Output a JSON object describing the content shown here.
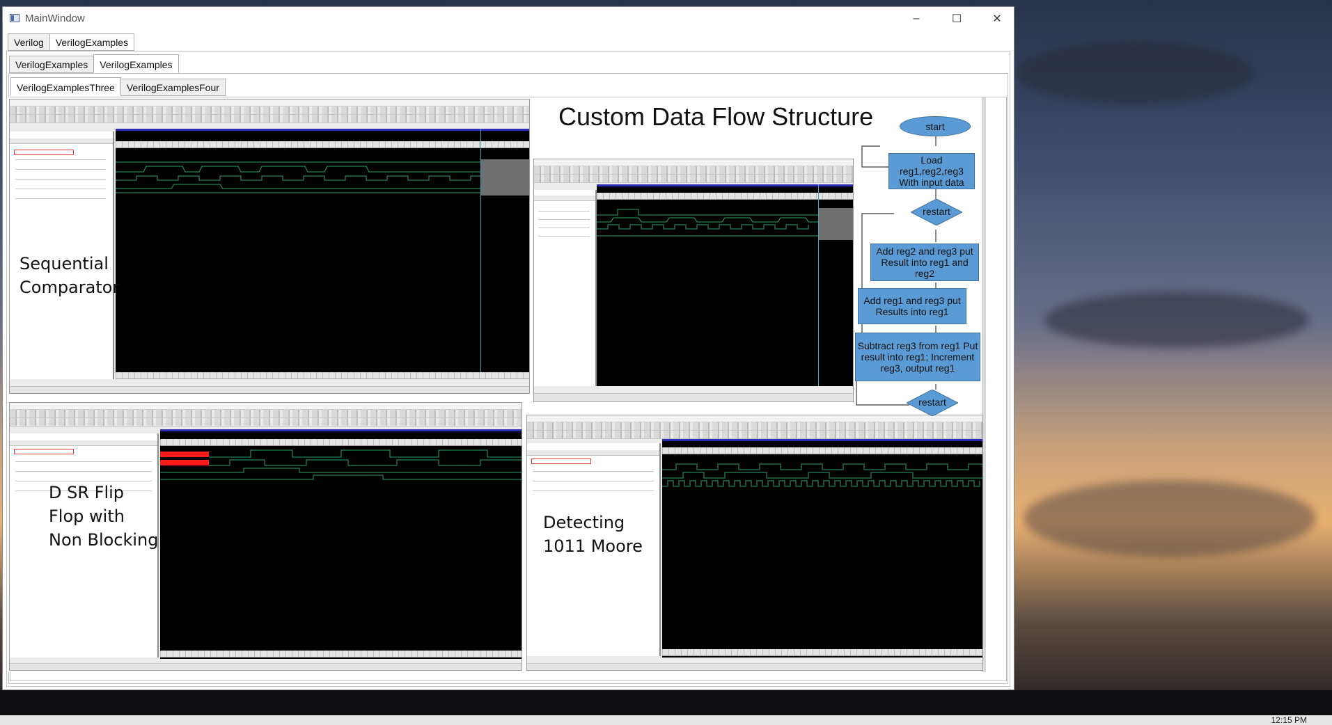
{
  "window": {
    "title": "MainWindow",
    "minimize": "–",
    "maximize": "☐",
    "close": "✕"
  },
  "tabs_level1": [
    "Verilog",
    "VerilogExamples"
  ],
  "tabs_level2": [
    "VerilogExamples",
    "VerilogExamples"
  ],
  "tabs_level3": [
    "VerilogExamplesThree",
    "VerilogExamplesFour"
  ],
  "slide": {
    "heading": "Custom Data Flow Structure",
    "panels": [
      {
        "label_line1": "Sequential",
        "label_line2": "Comparator"
      },
      {
        "label_line1": "D SR Flip",
        "label_line2": "Flop with",
        "label_line3": "Non Blocking"
      },
      {
        "label_line1": "Detecting",
        "label_line2": "1011 Moore"
      }
    ],
    "flowchart": {
      "start": "start",
      "load": "Load reg1,reg2,reg3 With input data",
      "restart1": "restart",
      "add23": "Add reg2 and reg3 put Result into reg1 and reg2",
      "add13": "Add reg1 and reg3 put Results into reg1",
      "subtract": "Subtract reg3 from reg1 Put result into reg1; Increment reg3, output reg1",
      "restart2": "restart"
    },
    "colors": {
      "shape_fill": "#5b9bd5",
      "shape_border": "#41719c",
      "wave": "#2fa36b",
      "cursor": "#3aa7a8"
    }
  },
  "taskbar": {
    "clock": "12:15 PM"
  }
}
